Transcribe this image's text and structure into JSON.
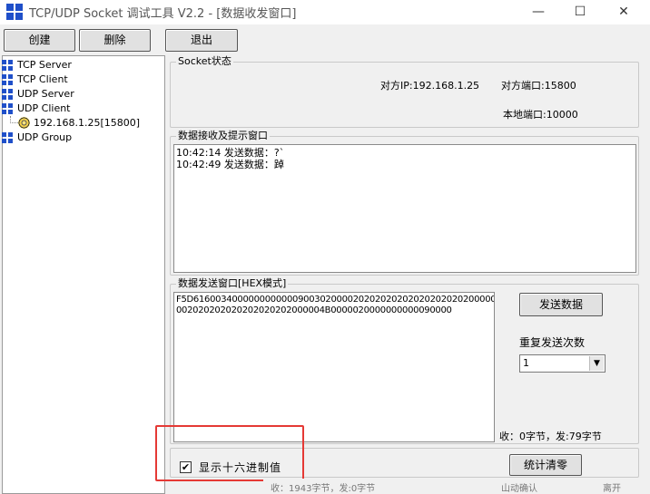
{
  "window": {
    "title": "TCP/UDP Socket 调试工具 V2.2 - [数据收发窗口]",
    "minimize_glyph": "—",
    "maximize_glyph": "☐",
    "close_glyph": "✕"
  },
  "toolbar": {
    "create_label": "创建",
    "delete_label": "删除",
    "exit_label": "退出"
  },
  "tree": {
    "items": [
      {
        "label": "TCP Server"
      },
      {
        "label": "TCP Client"
      },
      {
        "label": "UDP Server"
      },
      {
        "label": "UDP Client"
      },
      {
        "label": "192.168.1.25[15800]"
      },
      {
        "label": "UDP Group"
      }
    ]
  },
  "socket_status": {
    "title": "Socket状态",
    "remote_ip": "对方IP:192.168.1.25",
    "remote_port": "对方端口:15800",
    "local_port": "本地端口:10000"
  },
  "receive": {
    "title": "数据接收及提示窗口",
    "lines": [
      "10:42:14 发送数据：?`",
      "10:42:49 发送数据：踔"
    ]
  },
  "send": {
    "title": "数据发送窗口[HEX模式]",
    "lines": [
      "F5D616003400000000000090030200002020202020202020202020000004B",
      "002020202020202020202000004B0000020000000000090000"
    ],
    "send_button": "发送数据",
    "repeat_label": "重复发送次数",
    "repeat_value": "1",
    "counter": "收：0字节，发:79字节"
  },
  "bottom": {
    "hex_checkbox_label": "显示十六进制值",
    "hex_checked": "✔",
    "clear_button": "统计清零"
  },
  "behind_text": [
    "收：1943字节，发:0字节",
    "山动确认",
    "离开"
  ],
  "colors": {
    "accent_icon": "#1f4fc9",
    "highlight": "#e53935"
  }
}
